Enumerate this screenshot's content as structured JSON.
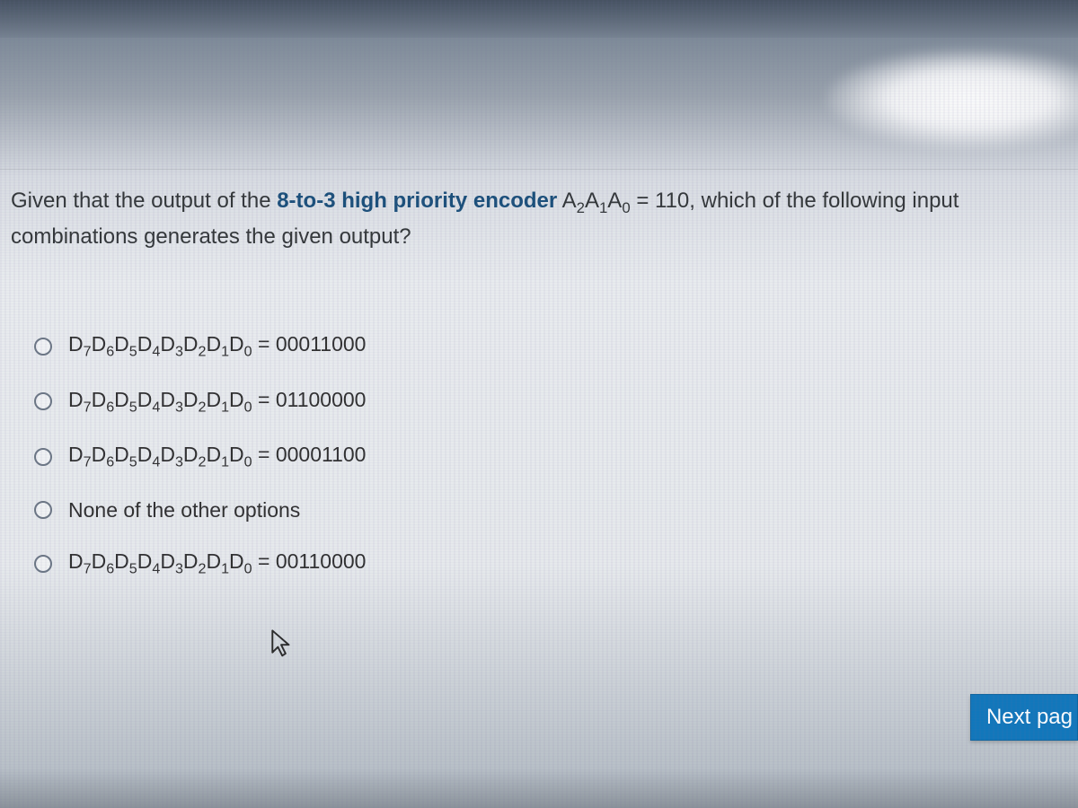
{
  "question": {
    "pre": "Given that the output of the ",
    "hl1": "8-to-3 high priority encoder",
    "mid": " A",
    "sub2": "2",
    "a1": "A",
    "sub1": "1",
    "a0": "A",
    "sub0": "0",
    "eq": " = 110, which of the following input combinations generates the given output?"
  },
  "inputs_label": {
    "d7": "D",
    "s7": "7",
    "d6": "D",
    "s6": "6",
    "d5": "D",
    "s5": "5",
    "d4": "D",
    "s4": "4",
    "d3": "D",
    "s3": "3",
    "d2": "D",
    "s2": "2",
    "d1": "D",
    "s1": "1",
    "d0": "D",
    "s0": "0"
  },
  "options": [
    {
      "value": "00011000",
      "is_none": false
    },
    {
      "value": "01100000",
      "is_none": false
    },
    {
      "value": "00001100",
      "is_none": false
    },
    {
      "value": "",
      "is_none": true,
      "none_text": "None of the other options"
    },
    {
      "value": "00110000",
      "is_none": false
    }
  ],
  "eqword": " = ",
  "next_button": "Next pag",
  "cursor_name": "cursor-icon"
}
